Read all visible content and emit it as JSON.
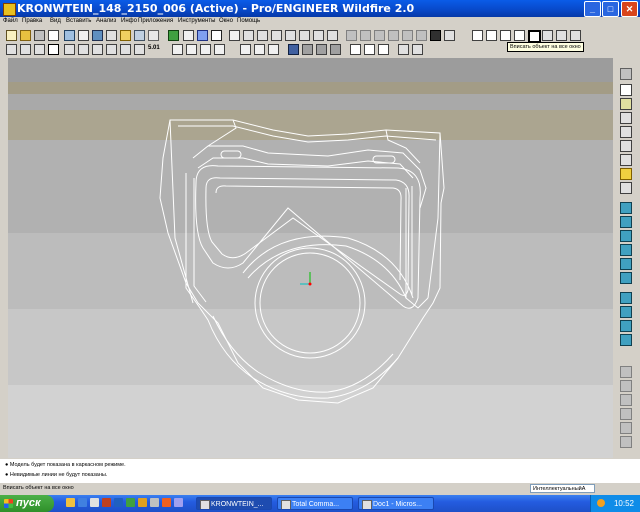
{
  "window": {
    "title": "KRONWTEIN_148_2150_006 (Active) - Pro/ENGINEER Wildfire 2.0",
    "minimize": "_",
    "maximize": "□",
    "close": "✕"
  },
  "menu": {
    "items": [
      "Файл",
      "Правка",
      "Вид",
      "Вставить",
      "Анализ",
      "Инфо",
      "Приложения",
      "Инструменты",
      "Окно",
      "Помощь"
    ]
  },
  "toolbar": {
    "tooltip": "Вписать объект на все окно",
    "scale_label": "5.01"
  },
  "messages": {
    "line1": "● Модель будет показана в каркасном режиме.",
    "line2": "● Невидимые линии не будут показаны."
  },
  "statusbar": {
    "text": "Вписать объект на все окно",
    "filter_value": "ИнтеллектуальныйА"
  },
  "taskbar": {
    "start_label": "пуск",
    "tasks": [
      "KRONWTEIN_...",
      "Total Comma...",
      "Doc1 - Micros..."
    ],
    "clock": "10:52"
  }
}
